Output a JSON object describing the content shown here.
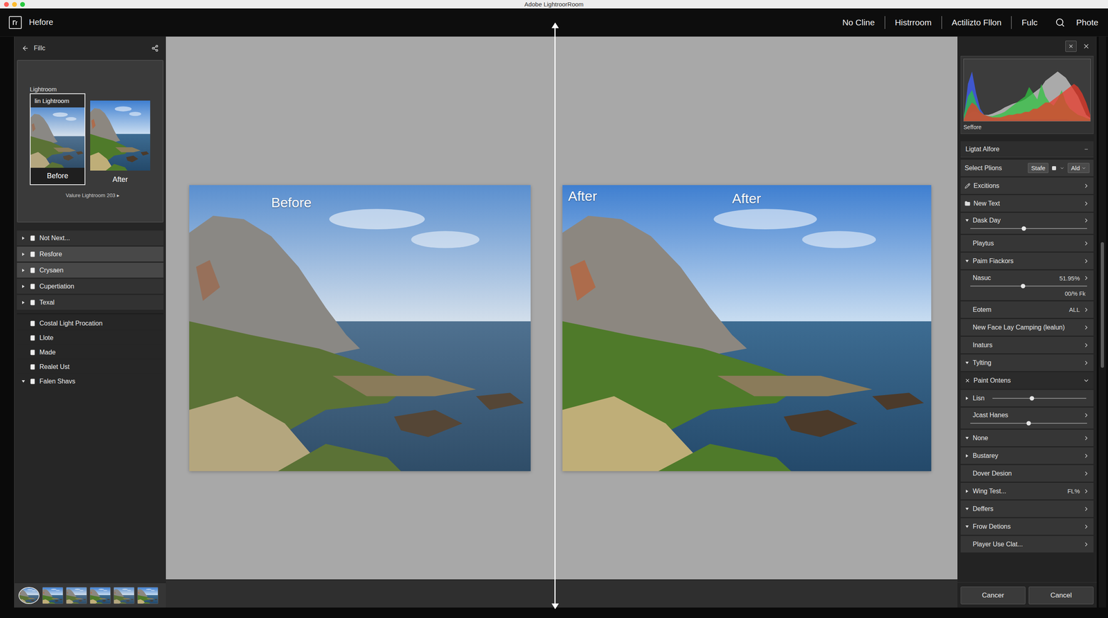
{
  "window": {
    "title": "Adobe LightroorRoom",
    "traffic_lights": [
      {
        "color": "#ff5f57"
      },
      {
        "color": "#febc2e"
      },
      {
        "color": "#28c840"
      }
    ]
  },
  "toolbar": {
    "title": "Hefore",
    "nav": [
      {
        "label": "No Cline"
      },
      {
        "label": "Histrroom"
      },
      {
        "label": "Actilizto Fllon"
      },
      {
        "label": "Fulc"
      }
    ],
    "account": "Phote"
  },
  "left_panel": {
    "back": "Fillc",
    "preview": {
      "title": "Lightroom",
      "thumbs": [
        {
          "tag": "lin Lightroom",
          "caption": "Before",
          "selected": true
        },
        {
          "caption": "After",
          "selected": false
        }
      ],
      "footer": "Valure Lightroom 203 ▸"
    },
    "groups": [
      [
        {
          "label": "Not Next...",
          "selected": false,
          "expanded": false
        },
        {
          "label": "Resfore",
          "selected": true,
          "expanded": false
        },
        {
          "label": "Crysaen",
          "selected": true,
          "expanded": false
        },
        {
          "label": "Cupertiation",
          "selected": false,
          "expanded": false
        },
        {
          "label": "Texal",
          "selected": false,
          "expanded": false
        }
      ],
      [
        {
          "label": "Costal Light Procation",
          "selected": false
        },
        {
          "label": "Llote",
          "selected": false
        },
        {
          "label": "Made",
          "selected": false
        },
        {
          "label": "Realet Ust",
          "selected": false
        },
        {
          "label": "Falen Shavs",
          "selected": false,
          "expanded": true
        }
      ]
    ],
    "filmstrip": [
      {
        "selected": true
      },
      {
        "selected": false
      },
      {
        "selected": false
      },
      {
        "selected": false
      },
      {
        "selected": false
      },
      {
        "selected": false
      }
    ]
  },
  "compare": {
    "photos": [
      {
        "tone": "muted",
        "labels": [
          {
            "text": "Before",
            "kind": "caption"
          }
        ]
      },
      {
        "tone": "vivid",
        "labels": [
          {
            "text": "After",
            "kind": "corner"
          },
          {
            "text": "After",
            "kind": "center"
          }
        ]
      }
    ]
  },
  "right_panel": {
    "histogram": {
      "label": "Seffore",
      "series": [
        {
          "name": "luma",
          "color": "#d8d8d8",
          "values": [
            5,
            10,
            15,
            15,
            12,
            10,
            10,
            12,
            15,
            18,
            22,
            25,
            28,
            30,
            32,
            35,
            40,
            45,
            50,
            55,
            65,
            70,
            75,
            80,
            75,
            70,
            60,
            50,
            40,
            25,
            10,
            5
          ]
        },
        {
          "name": "blue",
          "color": "#4060ff",
          "values": [
            5,
            60,
            80,
            45,
            20,
            10,
            8,
            5,
            4,
            3,
            3,
            3,
            3,
            3,
            3,
            3,
            3,
            3,
            3,
            3,
            3,
            3,
            3,
            3,
            3,
            3,
            2,
            2,
            2,
            2,
            2,
            2
          ]
        },
        {
          "name": "green",
          "color": "#30c040",
          "values": [
            10,
            40,
            50,
            30,
            15,
            10,
            8,
            8,
            10,
            12,
            15,
            20,
            25,
            30,
            35,
            40,
            55,
            45,
            35,
            60,
            40,
            30,
            25,
            35,
            50,
            30,
            20,
            15,
            10,
            8,
            5,
            3
          ]
        },
        {
          "name": "red",
          "color": "#e83a2a",
          "values": [
            3,
            20,
            30,
            25,
            15,
            10,
            8,
            6,
            6,
            6,
            8,
            10,
            10,
            12,
            12,
            15,
            15,
            20,
            20,
            25,
            30,
            30,
            35,
            40,
            45,
            50,
            55,
            60,
            55,
            45,
            30,
            10
          ]
        }
      ]
    },
    "section": "Ligtat Alfore",
    "rows": [
      {
        "label": "Select Plions",
        "kind": "select",
        "options": [
          "Stafe",
          "Ald"
        ]
      },
      {
        "label": "Excitions",
        "kind": "edit"
      },
      {
        "label": "New Text",
        "kind": "folder"
      },
      {
        "label": "Dask Day",
        "kind": "slider",
        "expanded": true,
        "level": 0.46
      },
      {
        "label": "Playtus",
        "kind": "row"
      },
      {
        "label": "Paim Fiackors",
        "kind": "row",
        "expanded": true
      },
      {
        "label": "Nasuc",
        "kind": "slider",
        "value": "51.95%",
        "level": 0.45,
        "note": "00/% Fk"
      },
      {
        "label": "Eotem",
        "kind": "row",
        "value": "ALL"
      },
      {
        "label": "New Face Lay Camping (lealun)",
        "kind": "row"
      },
      {
        "label": "Inaturs",
        "kind": "row"
      },
      {
        "label": "Tylting",
        "kind": "row",
        "expanded": true
      },
      {
        "label": "Paint Ontens",
        "kind": "header"
      },
      {
        "label": "Lisn",
        "kind": "inline-slider",
        "expanded": false,
        "level": 0.42
      },
      {
        "label": "Jcast Hanes",
        "kind": "slider",
        "level": 0.5
      },
      {
        "label": "None",
        "kind": "row",
        "expanded": true
      },
      {
        "label": "Bustarey",
        "kind": "row",
        "expanded": false
      },
      {
        "label": "Dover Desion",
        "kind": "row"
      },
      {
        "label": "Wing Test...",
        "kind": "row",
        "expanded": false,
        "value": "FL%"
      },
      {
        "label": "Deffers",
        "kind": "row",
        "expanded": true
      },
      {
        "label": "Frow Detions",
        "kind": "row",
        "expanded": true
      },
      {
        "label": "Player Use Clat...",
        "kind": "row"
      }
    ],
    "buttons": [
      "Cancer",
      "Cancel"
    ],
    "scrollbar": {
      "offset": 0.36,
      "size": 0.22
    }
  }
}
